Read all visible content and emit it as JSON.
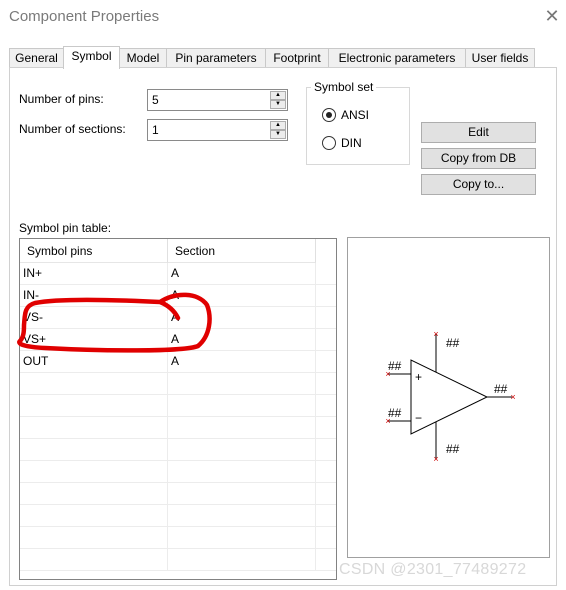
{
  "window": {
    "title": "Component Properties",
    "close_glyph": "✕"
  },
  "tabs": [
    {
      "label": "General"
    },
    {
      "label": "Symbol"
    },
    {
      "label": "Model"
    },
    {
      "label": "Pin parameters"
    },
    {
      "label": "Footprint"
    },
    {
      "label": "Electronic parameters"
    },
    {
      "label": "User fields"
    }
  ],
  "active_tab": "Symbol",
  "fields": {
    "num_pins": {
      "label": "Number of pins:",
      "value": "5"
    },
    "num_sections": {
      "label": "Number of sections:",
      "value": "1"
    }
  },
  "symbol_set": {
    "legend": "Symbol set",
    "options": [
      {
        "label": "ANSI",
        "selected": true
      },
      {
        "label": "DIN",
        "selected": false
      }
    ]
  },
  "buttons": {
    "edit": "Edit",
    "copy_from_db": "Copy from DB",
    "copy_to": "Copy to..."
  },
  "pin_table": {
    "label": "Symbol pin table:",
    "headers": [
      "Symbol pins",
      "Section"
    ],
    "rows": [
      {
        "pin": "IN+",
        "section": "A"
      },
      {
        "pin": "IN-",
        "section": "A"
      },
      {
        "pin": "VS-",
        "section": "A"
      },
      {
        "pin": "VS+",
        "section": "A"
      },
      {
        "pin": "OUT",
        "section": "A"
      }
    ]
  },
  "preview": {
    "plus": "+",
    "minus": "−",
    "pin_placeholder": "##",
    "pin_marker": "×"
  },
  "annotation": {
    "color": "#e00000"
  },
  "watermark": "CSDN @2301_77489272"
}
